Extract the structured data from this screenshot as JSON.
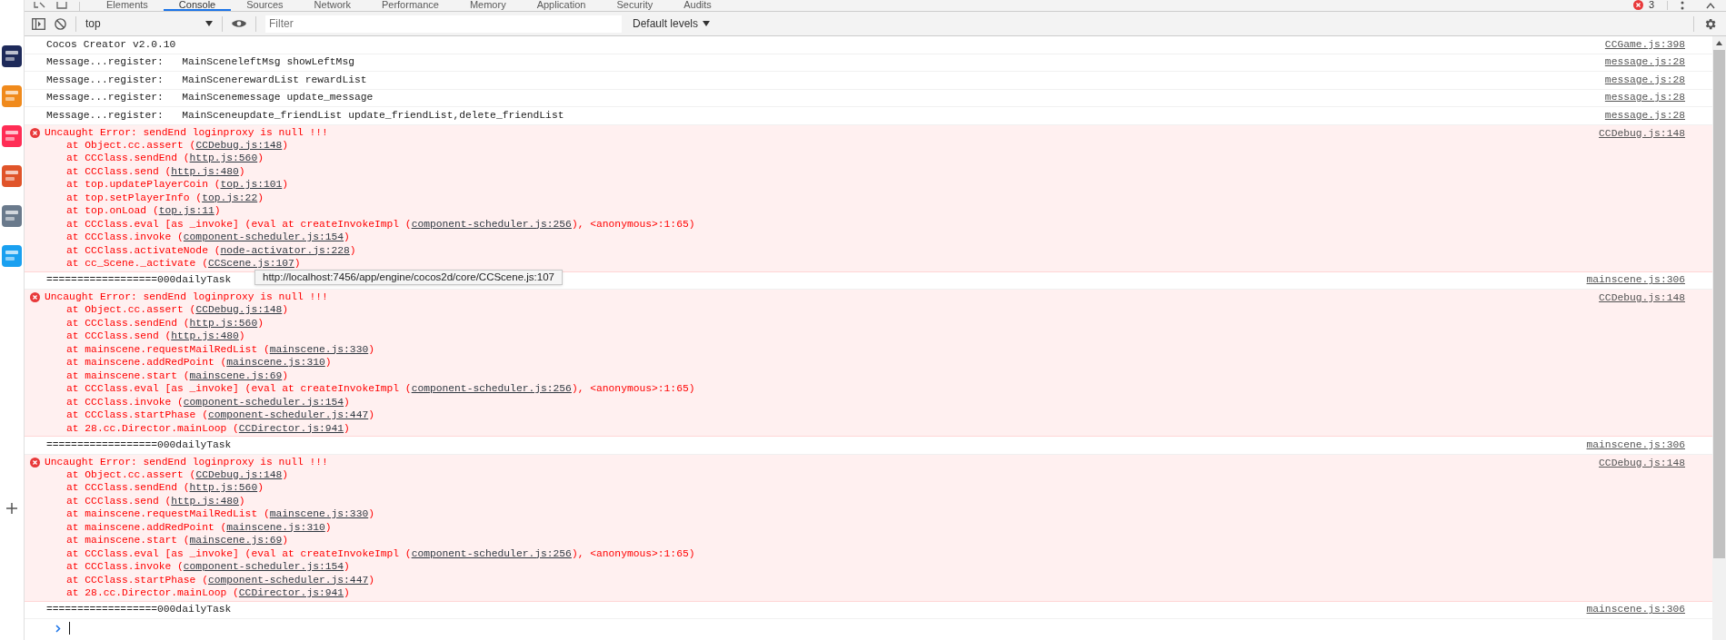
{
  "tabs": [
    {
      "label": "Elements",
      "selected": false
    },
    {
      "label": "Console",
      "selected": true
    },
    {
      "label": "Sources",
      "selected": false
    },
    {
      "label": "Network",
      "selected": false
    },
    {
      "label": "Performance",
      "selected": false
    },
    {
      "label": "Memory",
      "selected": false
    },
    {
      "label": "Application",
      "selected": false
    },
    {
      "label": "Security",
      "selected": false
    },
    {
      "label": "Audits",
      "selected": false
    }
  ],
  "error_count": "3",
  "toolbar": {
    "context": "top",
    "filter_placeholder": "Filter",
    "levels": "Default levels"
  },
  "messages": [
    {
      "kind": "log",
      "text": "Cocos Creator v2.0.10",
      "source": "CCGame.js:398"
    },
    {
      "kind": "log",
      "text": "Message...register:   MainSceneleftMsg showLeftMsg",
      "source": "message.js:28"
    },
    {
      "kind": "log",
      "text": "Message...register:   MainScenerewardList rewardList",
      "source": "message.js:28"
    },
    {
      "kind": "log",
      "text": "Message...register:   MainScenemessage update_message",
      "source": "message.js:28"
    },
    {
      "kind": "log",
      "text": "Message...register:   MainSceneupdate_friendList update_friendList,delete_friendList",
      "source": "message.js:28"
    },
    {
      "kind": "error",
      "text": "Uncaught Error: sendEnd loginproxy is null !!!",
      "source": "CCDebug.js:148",
      "stack": [
        {
          "before": "at Object.cc.assert (",
          "link": "CCDebug.js:148",
          "after": ")"
        },
        {
          "before": "at CCClass.sendEnd (",
          "link": "http.js:560",
          "after": ")"
        },
        {
          "before": "at CCClass.send (",
          "link": "http.js:480",
          "after": ")"
        },
        {
          "before": "at top.updatePlayerCoin (",
          "link": "top.js:101",
          "after": ")"
        },
        {
          "before": "at top.setPlayerInfo (",
          "link": "top.js:22",
          "after": ")"
        },
        {
          "before": "at top.onLoad (",
          "link": "top.js:11",
          "after": ")"
        },
        {
          "before": "at CCClass.eval [as _invoke] (eval at createInvokeImpl (",
          "link": "component-scheduler.js:256",
          "after": "), <anonymous>:1:65)"
        },
        {
          "before": "at CCClass.invoke (",
          "link": "component-scheduler.js:154",
          "after": ")"
        },
        {
          "before": "at CCClass.activateNode (",
          "link": "node-activator.js:228",
          "after": ")"
        },
        {
          "before": "at cc_Scene._activate (",
          "link": "CCScene.js:107",
          "after": ")"
        }
      ]
    },
    {
      "kind": "log",
      "text": "==================000dailyTask",
      "source": "mainscene.js:306"
    },
    {
      "kind": "error",
      "text": "Uncaught Error: sendEnd loginproxy is null !!!",
      "source": "CCDebug.js:148",
      "stack": [
        {
          "before": "at Object.cc.assert (",
          "link": "CCDebug.js:148",
          "after": ")"
        },
        {
          "before": "at CCClass.sendEnd (",
          "link": "http.js:560",
          "after": ")"
        },
        {
          "before": "at CCClass.send (",
          "link": "http.js:480",
          "after": ")"
        },
        {
          "before": "at mainscene.requestMailRedList (",
          "link": "mainscene.js:330",
          "after": ")"
        },
        {
          "before": "at mainscene.addRedPoint (",
          "link": "mainscene.js:310",
          "after": ")"
        },
        {
          "before": "at mainscene.start (",
          "link": "mainscene.js:69",
          "after": ")"
        },
        {
          "before": "at CCClass.eval [as _invoke] (eval at createInvokeImpl (",
          "link": "component-scheduler.js:256",
          "after": "), <anonymous>:1:65)"
        },
        {
          "before": "at CCClass.invoke (",
          "link": "component-scheduler.js:154",
          "after": ")"
        },
        {
          "before": "at CCClass.startPhase (",
          "link": "component-scheduler.js:447",
          "after": ")"
        },
        {
          "before": "at 28.cc.Director.mainLoop (",
          "link": "CCDirector.js:941",
          "after": ")"
        }
      ]
    },
    {
      "kind": "log",
      "text": "==================000dailyTask",
      "source": "mainscene.js:306"
    },
    {
      "kind": "error",
      "text": "Uncaught Error: sendEnd loginproxy is null !!!",
      "source": "CCDebug.js:148",
      "stack": [
        {
          "before": "at Object.cc.assert (",
          "link": "CCDebug.js:148",
          "after": ")"
        },
        {
          "before": "at CCClass.sendEnd (",
          "link": "http.js:560",
          "after": ")"
        },
        {
          "before": "at CCClass.send (",
          "link": "http.js:480",
          "after": ")"
        },
        {
          "before": "at mainscene.requestMailRedList (",
          "link": "mainscene.js:330",
          "after": ")"
        },
        {
          "before": "at mainscene.addRedPoint (",
          "link": "mainscene.js:310",
          "after": ")"
        },
        {
          "before": "at mainscene.start (",
          "link": "mainscene.js:69",
          "after": ")"
        },
        {
          "before": "at CCClass.eval [as _invoke] (eval at createInvokeImpl (",
          "link": "component-scheduler.js:256",
          "after": "), <anonymous>:1:65)"
        },
        {
          "before": "at CCClass.invoke (",
          "link": "component-scheduler.js:154",
          "after": ")"
        },
        {
          "before": "at CCClass.startPhase (",
          "link": "component-scheduler.js:447",
          "after": ")"
        },
        {
          "before": "at 28.cc.Director.mainLoop (",
          "link": "CCDirector.js:941",
          "after": ")"
        }
      ]
    },
    {
      "kind": "log",
      "text": "==================000dailyTask",
      "source": "mainscene.js:306"
    }
  ],
  "tooltip": {
    "text": "http://localhost:7456/app/engine/cocos2d/core/CCScene.js:107"
  }
}
